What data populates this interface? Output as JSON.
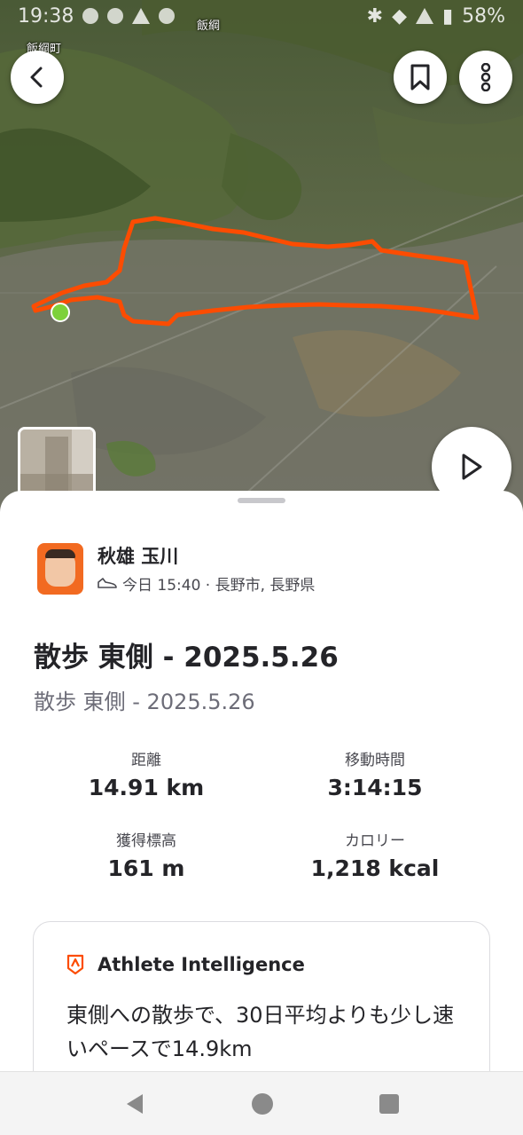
{
  "status_bar": {
    "time": "19:38",
    "battery": "58%"
  },
  "map": {
    "place_label_top": "飯綱",
    "place_label_left": "飯綱町",
    "route_color": "#fc4c02",
    "start_marker_color": "#7dd13a"
  },
  "icons": {
    "back": "chevron-left-icon",
    "bookmark": "bookmark-icon",
    "more": "more-vertical-icon",
    "play": "play-icon",
    "shoe": "shoe-icon",
    "athlete_intelligence": "athlete-intelligence-icon"
  },
  "athlete": {
    "name": "秋雄 玉川",
    "meta": "今日 15:40 · 長野市, 長野県"
  },
  "activity": {
    "title": "散歩 東側 - 2025.5.26",
    "description": "散歩 東側 - 2025.5.26"
  },
  "stats": [
    {
      "label": "距離",
      "value": "14.91 km"
    },
    {
      "label": "移動時間",
      "value": "3:14:15"
    },
    {
      "label": "獲得標高",
      "value": "161 m"
    },
    {
      "label": "カロリー",
      "value": "1,218 kcal"
    }
  ],
  "intelligence": {
    "title": "Athlete Intelligence",
    "text": "東側への散歩で、30日平均よりも少し速いペースで14.9km"
  },
  "colors": {
    "brand": "#fc4c02",
    "text": "#242428",
    "muted": "#6d6d78"
  }
}
